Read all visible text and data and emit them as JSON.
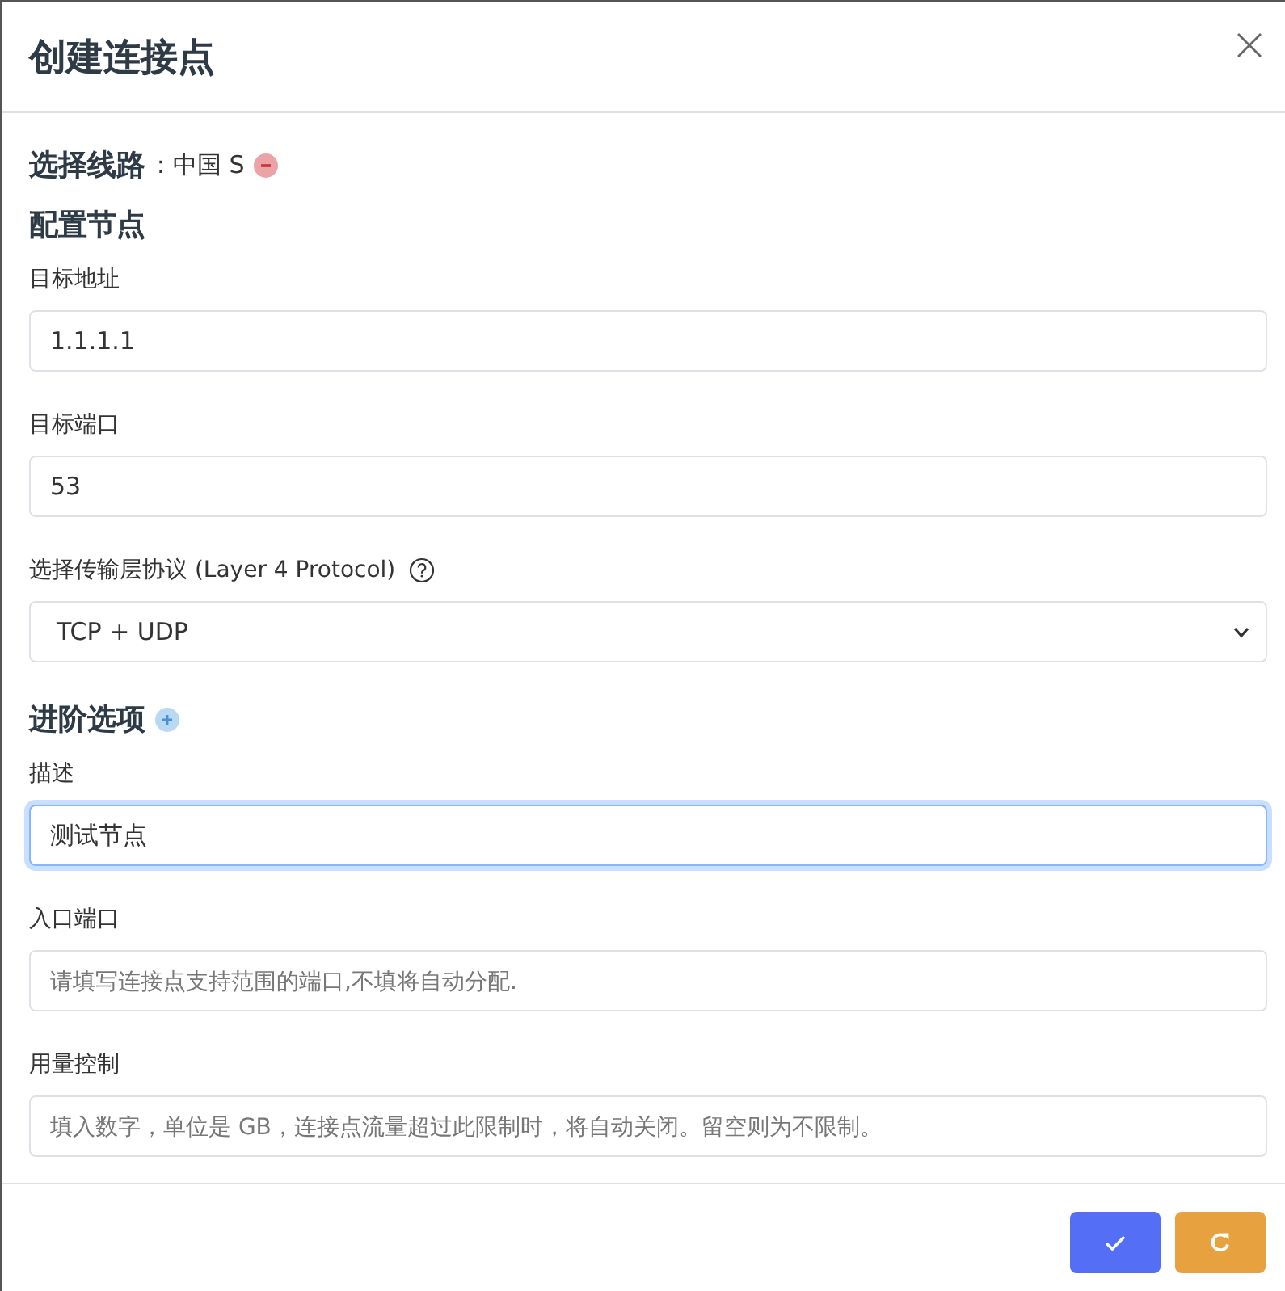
{
  "dialog": {
    "title": "创建连接点"
  },
  "route": {
    "label": "选择线路",
    "value": "：中国 S"
  },
  "sections": [
    {
      "heading": "配置节点",
      "kind": "plain",
      "fields": [
        {
          "label": "目标地址",
          "kind": "input",
          "value": "1.1.1.1",
          "help": false,
          "focused": false
        },
        {
          "label": "目标端口",
          "kind": "input",
          "value": "53",
          "help": false,
          "focused": false
        },
        {
          "label": "选择传输层协议 (Layer 4 Protocol)",
          "kind": "select",
          "value": "TCP + UDP",
          "help": true,
          "focused": false
        }
      ]
    },
    {
      "heading": "进阶选项",
      "kind": "expandable",
      "fields": [
        {
          "label": "描述",
          "kind": "input",
          "value": "测试节点",
          "help": false,
          "focused": true
        },
        {
          "label": "入口端口",
          "kind": "input",
          "placeholder": "请填写连接点支持范围的端口,不填将自动分配.",
          "help": false,
          "focused": false
        },
        {
          "label": "用量控制",
          "kind": "input",
          "placeholder": "填入数字，单位是 GB，连接点流量超过此限制时，将自动关闭。留空则为不限制。",
          "help": false,
          "focused": false
        }
      ]
    }
  ],
  "buttons": [
    {
      "kind": "confirm"
    },
    {
      "kind": "reset"
    }
  ]
}
